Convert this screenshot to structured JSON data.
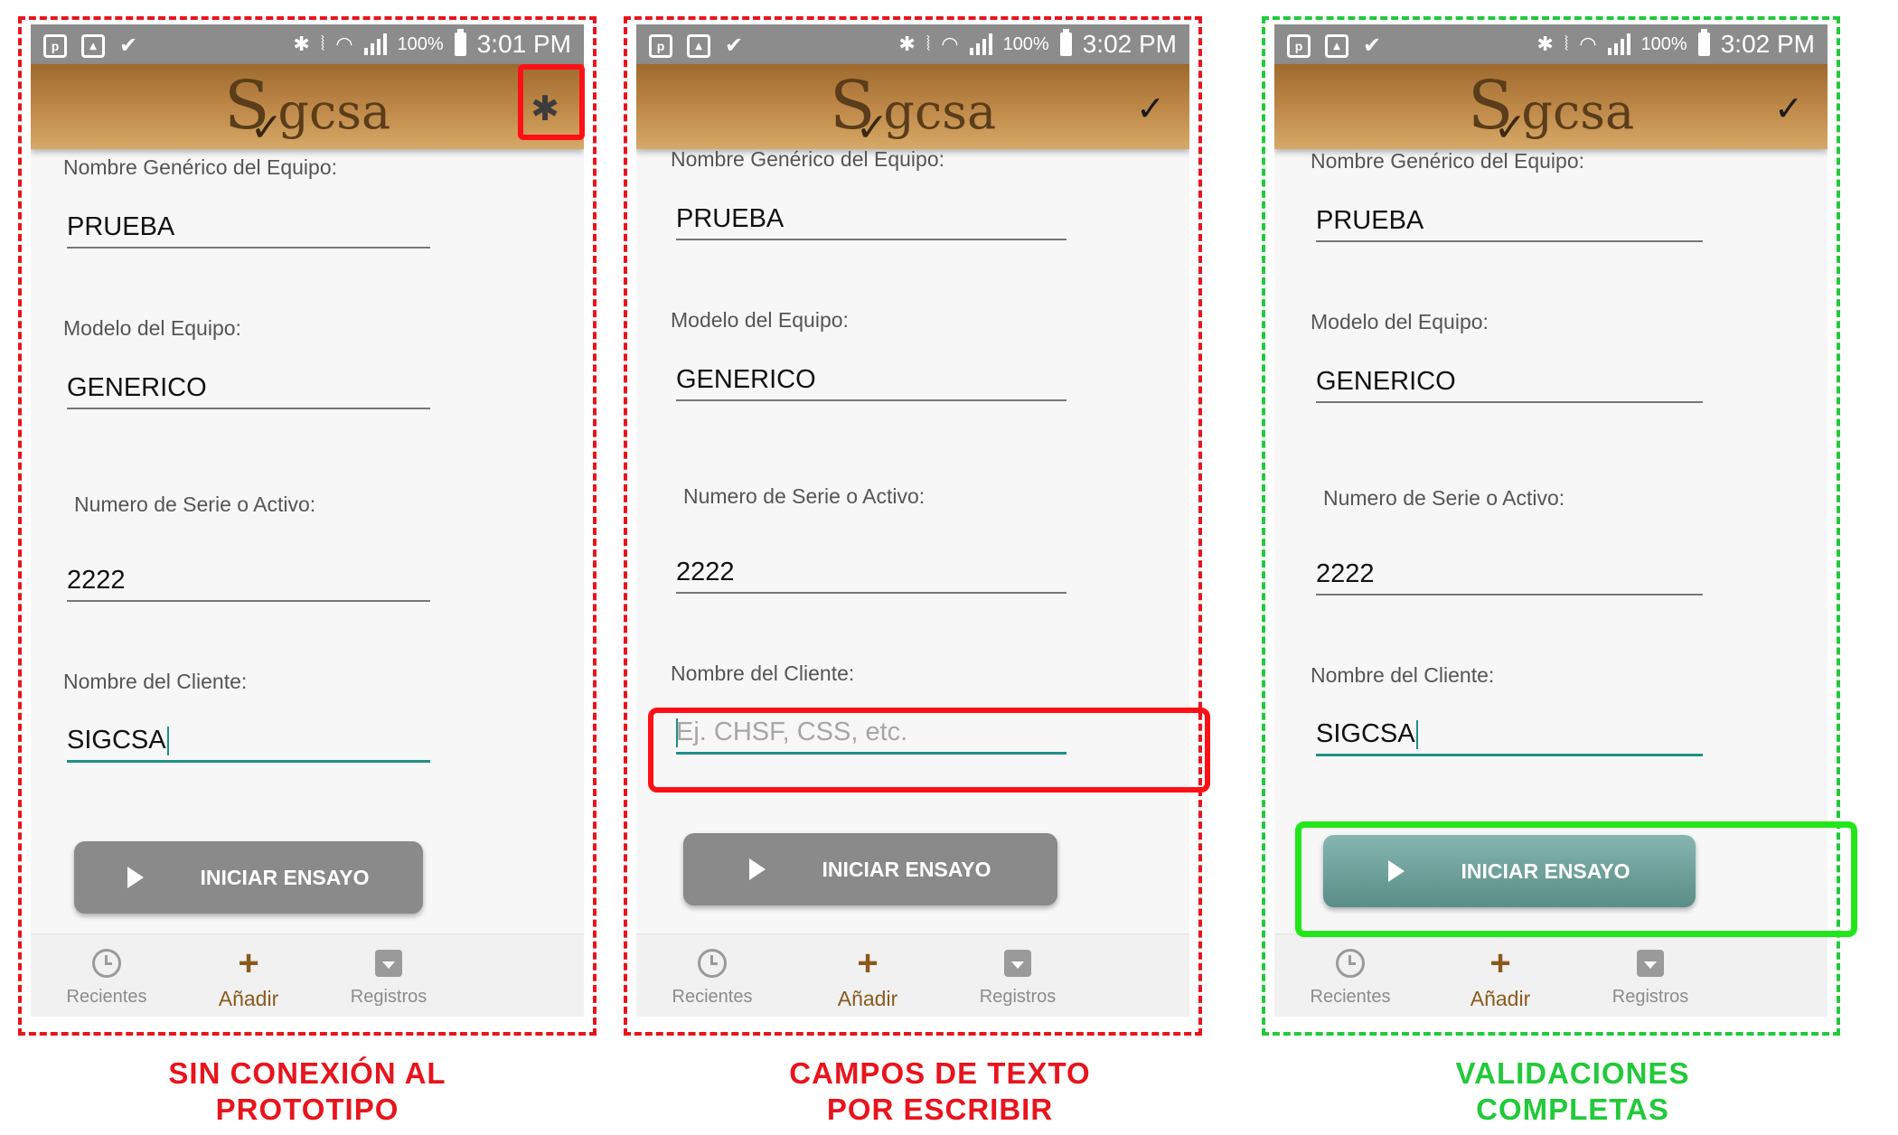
{
  "panels": [
    {
      "status": {
        "battery": "100%",
        "time": "3:01 PM"
      },
      "app": {
        "logo_initial": "S",
        "logo_rest": "gcsa",
        "action_icon": "bluetooth-off-icon"
      },
      "form": {
        "generic_name_label": "Nombre Genérico del Equipo:",
        "generic_name_value": "PRUEBA",
        "model_label": "Modelo del Equipo:",
        "model_value": "GENERICO",
        "serial_label": "Numero de Serie o Activo:",
        "serial_value": "2222",
        "client_label": "Nombre del Cliente:",
        "client_value": "SIGCSA"
      },
      "button": {
        "label": "INICIAR ENSAYO",
        "state": "disabled"
      },
      "nav": {
        "recent": "Recientes",
        "add": "Añadir",
        "records": "Registros"
      },
      "caption": [
        "SIN CONEXIÓN AL",
        "PROTOTIPO"
      ]
    },
    {
      "status": {
        "battery": "100%",
        "time": "3:02 PM"
      },
      "app": {
        "logo_initial": "S",
        "logo_rest": "gcsa",
        "action_icon": "check-icon"
      },
      "form": {
        "generic_name_label": "Nombre Genérico del Equipo:",
        "generic_name_value": "PRUEBA",
        "model_label": "Modelo del Equipo:",
        "model_value": "GENERICO",
        "serial_label": "Numero de Serie o Activo:",
        "serial_value": "2222",
        "client_label": "Nombre del Cliente:",
        "client_placeholder": "Ej. CHSF, CSS, etc."
      },
      "button": {
        "label": "INICIAR ENSAYO",
        "state": "disabled"
      },
      "nav": {
        "recent": "Recientes",
        "add": "Añadir",
        "records": "Registros"
      },
      "caption": [
        "CAMPOS DE TEXTO",
        "POR ESCRIBIR"
      ]
    },
    {
      "status": {
        "battery": "100%",
        "time": "3:02 PM"
      },
      "app": {
        "logo_initial": "S",
        "logo_rest": "gcsa",
        "action_icon": "check-icon"
      },
      "form": {
        "generic_name_label": "Nombre Genérico del Equipo:",
        "generic_name_value": "PRUEBA",
        "model_label": "Modelo del Equipo:",
        "model_value": "GENERICO",
        "serial_label": "Numero de Serie o Activo:",
        "serial_value": "2222",
        "client_label": "Nombre del Cliente:",
        "client_value": "SIGCSA"
      },
      "button": {
        "label": "INICIAR ENSAYO",
        "state": "enabled"
      },
      "nav": {
        "recent": "Recientes",
        "add": "Añadir",
        "records": "Registros"
      },
      "caption": [
        "VALIDACIONES",
        "COMPLETAS"
      ]
    }
  ],
  "colors": {
    "error_red": "#e8141c",
    "ok_green": "#22c93a",
    "accent_teal": "#1f8f87",
    "brand_brown": "#8a5a1c"
  }
}
